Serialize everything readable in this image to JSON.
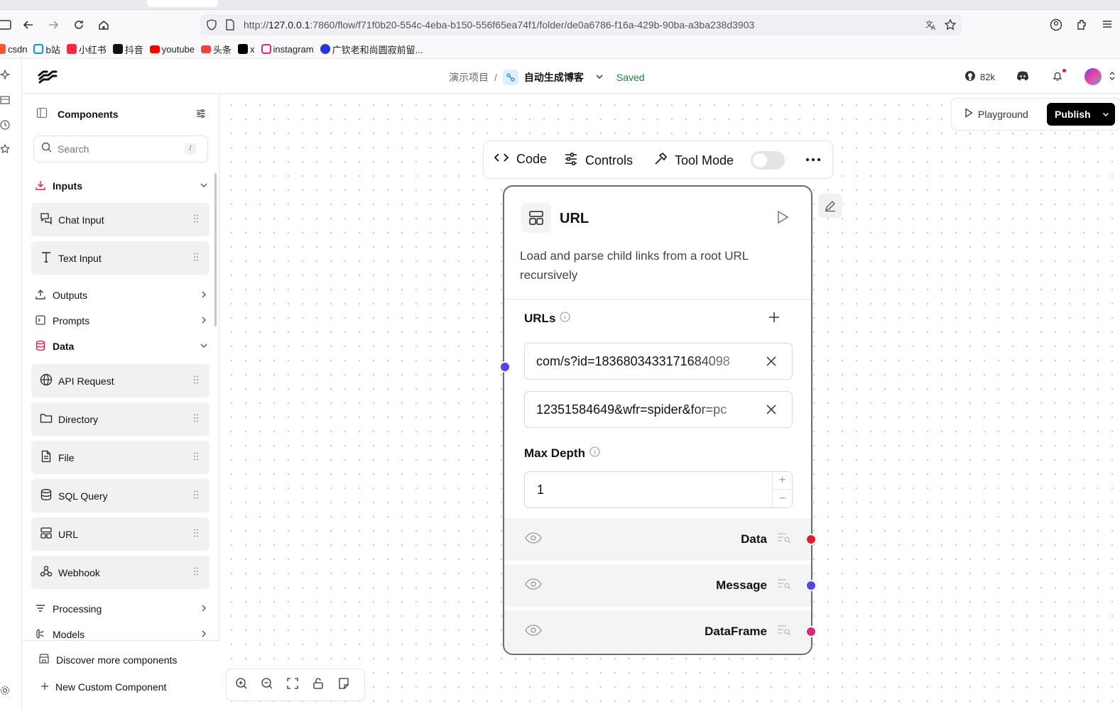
{
  "browser": {
    "url_prefix": "http://",
    "url_host": "127.0.0.1",
    "url_rest": ":7860/flow/f71f0b20-554c-4eba-b150-556f65ea74f1/folder/de0a6786-f16a-429b-90ba-a3ba238d3903",
    "bookmarks": [
      {
        "label": "csdn",
        "color": "#fc5531"
      },
      {
        "label": "b站",
        "color": "#00a1d6"
      },
      {
        "label": "小红书",
        "color": "#ff2442"
      },
      {
        "label": "抖音",
        "color": "#111111"
      },
      {
        "label": "youtube",
        "color": "#ff0000"
      },
      {
        "label": "头条",
        "color": "#f04142"
      },
      {
        "label": "x",
        "color": "#000000"
      },
      {
        "label": "instagram",
        "color": "#d62976"
      },
      {
        "label": "广钦老和尚圆寂前留...",
        "color": "#2932e1"
      }
    ]
  },
  "header": {
    "project": "演示项目",
    "separator": "/",
    "flow_name": "自动生成博客",
    "status": "Saved",
    "github_stars": "82k"
  },
  "sidebar": {
    "title": "Components",
    "search_placeholder": "Search",
    "search_shortcut": "/",
    "categories": {
      "inputs": "Inputs",
      "outputs": "Outputs",
      "prompts": "Prompts",
      "data": "Data",
      "processing": "Processing",
      "models": "Models"
    },
    "inputs_items": [
      "Chat Input",
      "Text Input"
    ],
    "data_items": [
      "API Request",
      "Directory",
      "File",
      "SQL Query",
      "URL",
      "Webhook"
    ],
    "footer": {
      "discover": "Discover more components",
      "custom": "New Custom Component"
    }
  },
  "canvas_actions": {
    "playground": "Playground",
    "publish": "Publish"
  },
  "node_toolbar": {
    "code": "Code",
    "controls": "Controls",
    "tool_mode": "Tool Mode",
    "tool_mode_on": false
  },
  "node": {
    "title": "URL",
    "description": "Load and parse child links from a root URL recursively",
    "urls_label": "URLs",
    "urls": [
      "com/s?id=1836803433171684098",
      "12351584649&wfr=spider&for=pc"
    ],
    "max_depth_label": "Max Depth",
    "max_depth": "1",
    "outputs": [
      {
        "label": "Data",
        "color": "#e11d2b"
      },
      {
        "label": "Message",
        "color": "#4f46e5"
      },
      {
        "label": "DataFrame",
        "color": "#db2777"
      }
    ],
    "input_handle_color": "#4f46e5"
  }
}
